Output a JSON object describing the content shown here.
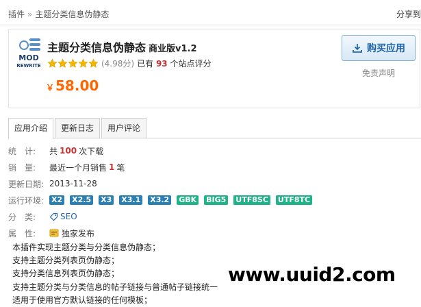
{
  "breadcrumb": {
    "root": "插件",
    "separator": "»",
    "current": "主题分类信息伪静态"
  },
  "share_label": "分享到",
  "plugin": {
    "name": "主题分类信息伪静态",
    "edition": "商业版v1.2",
    "rating_score": "(4.98分)",
    "rating_stars": 5,
    "sites_prefix": "已有",
    "sites_count": "93",
    "sites_suffix": "个站点评分",
    "currency": "￥",
    "price": "58.00"
  },
  "buy_button": "购买应用",
  "disclaimer": "免责声明",
  "tabs": [
    {
      "label": "应用介绍",
      "active": true
    },
    {
      "label": "更新日志",
      "active": false
    },
    {
      "label": "用户评论",
      "active": false
    }
  ],
  "info": {
    "downloads": {
      "label": "统　计:",
      "prefix": "共",
      "count": "100",
      "suffix": "次下载"
    },
    "sales": {
      "label": "销　量:",
      "prefix": "最近一个月销售",
      "count": "1",
      "suffix": "笔"
    },
    "updated": {
      "label": "更新日期:",
      "value": "2013-11-28"
    },
    "env": {
      "label": "运行环境:",
      "versions": [
        "X2",
        "X2.5",
        "X3",
        "X3.1",
        "X3.2"
      ],
      "charsets": [
        "GBK",
        "BIG5",
        "UTF8SC",
        "UTF8TC"
      ]
    },
    "category": {
      "label": "分　类:",
      "value": "SEO"
    },
    "property": {
      "label": "属　性:",
      "value": "独家发布"
    }
  },
  "description": [
    "本插件实现主题分类与分类信息伪静态；",
    "支持主题分类列表页伪静态；",
    "支持分类信息列表页伪静态；",
    "支持主题分类与分类信息的帖子链接与普通帖子链接统一",
    "适用于使用官方默认链接的任何模板；"
  ],
  "logo": {
    "line1": "MOD",
    "line2": "REWRITE"
  },
  "watermark": "www.uuid2.com",
  "colors": {
    "price": "#ff6600",
    "accent": "#2367a9",
    "badge_blue": "#2a7fb4",
    "badge_green": "#1fb38a",
    "star": "#f5b800"
  }
}
